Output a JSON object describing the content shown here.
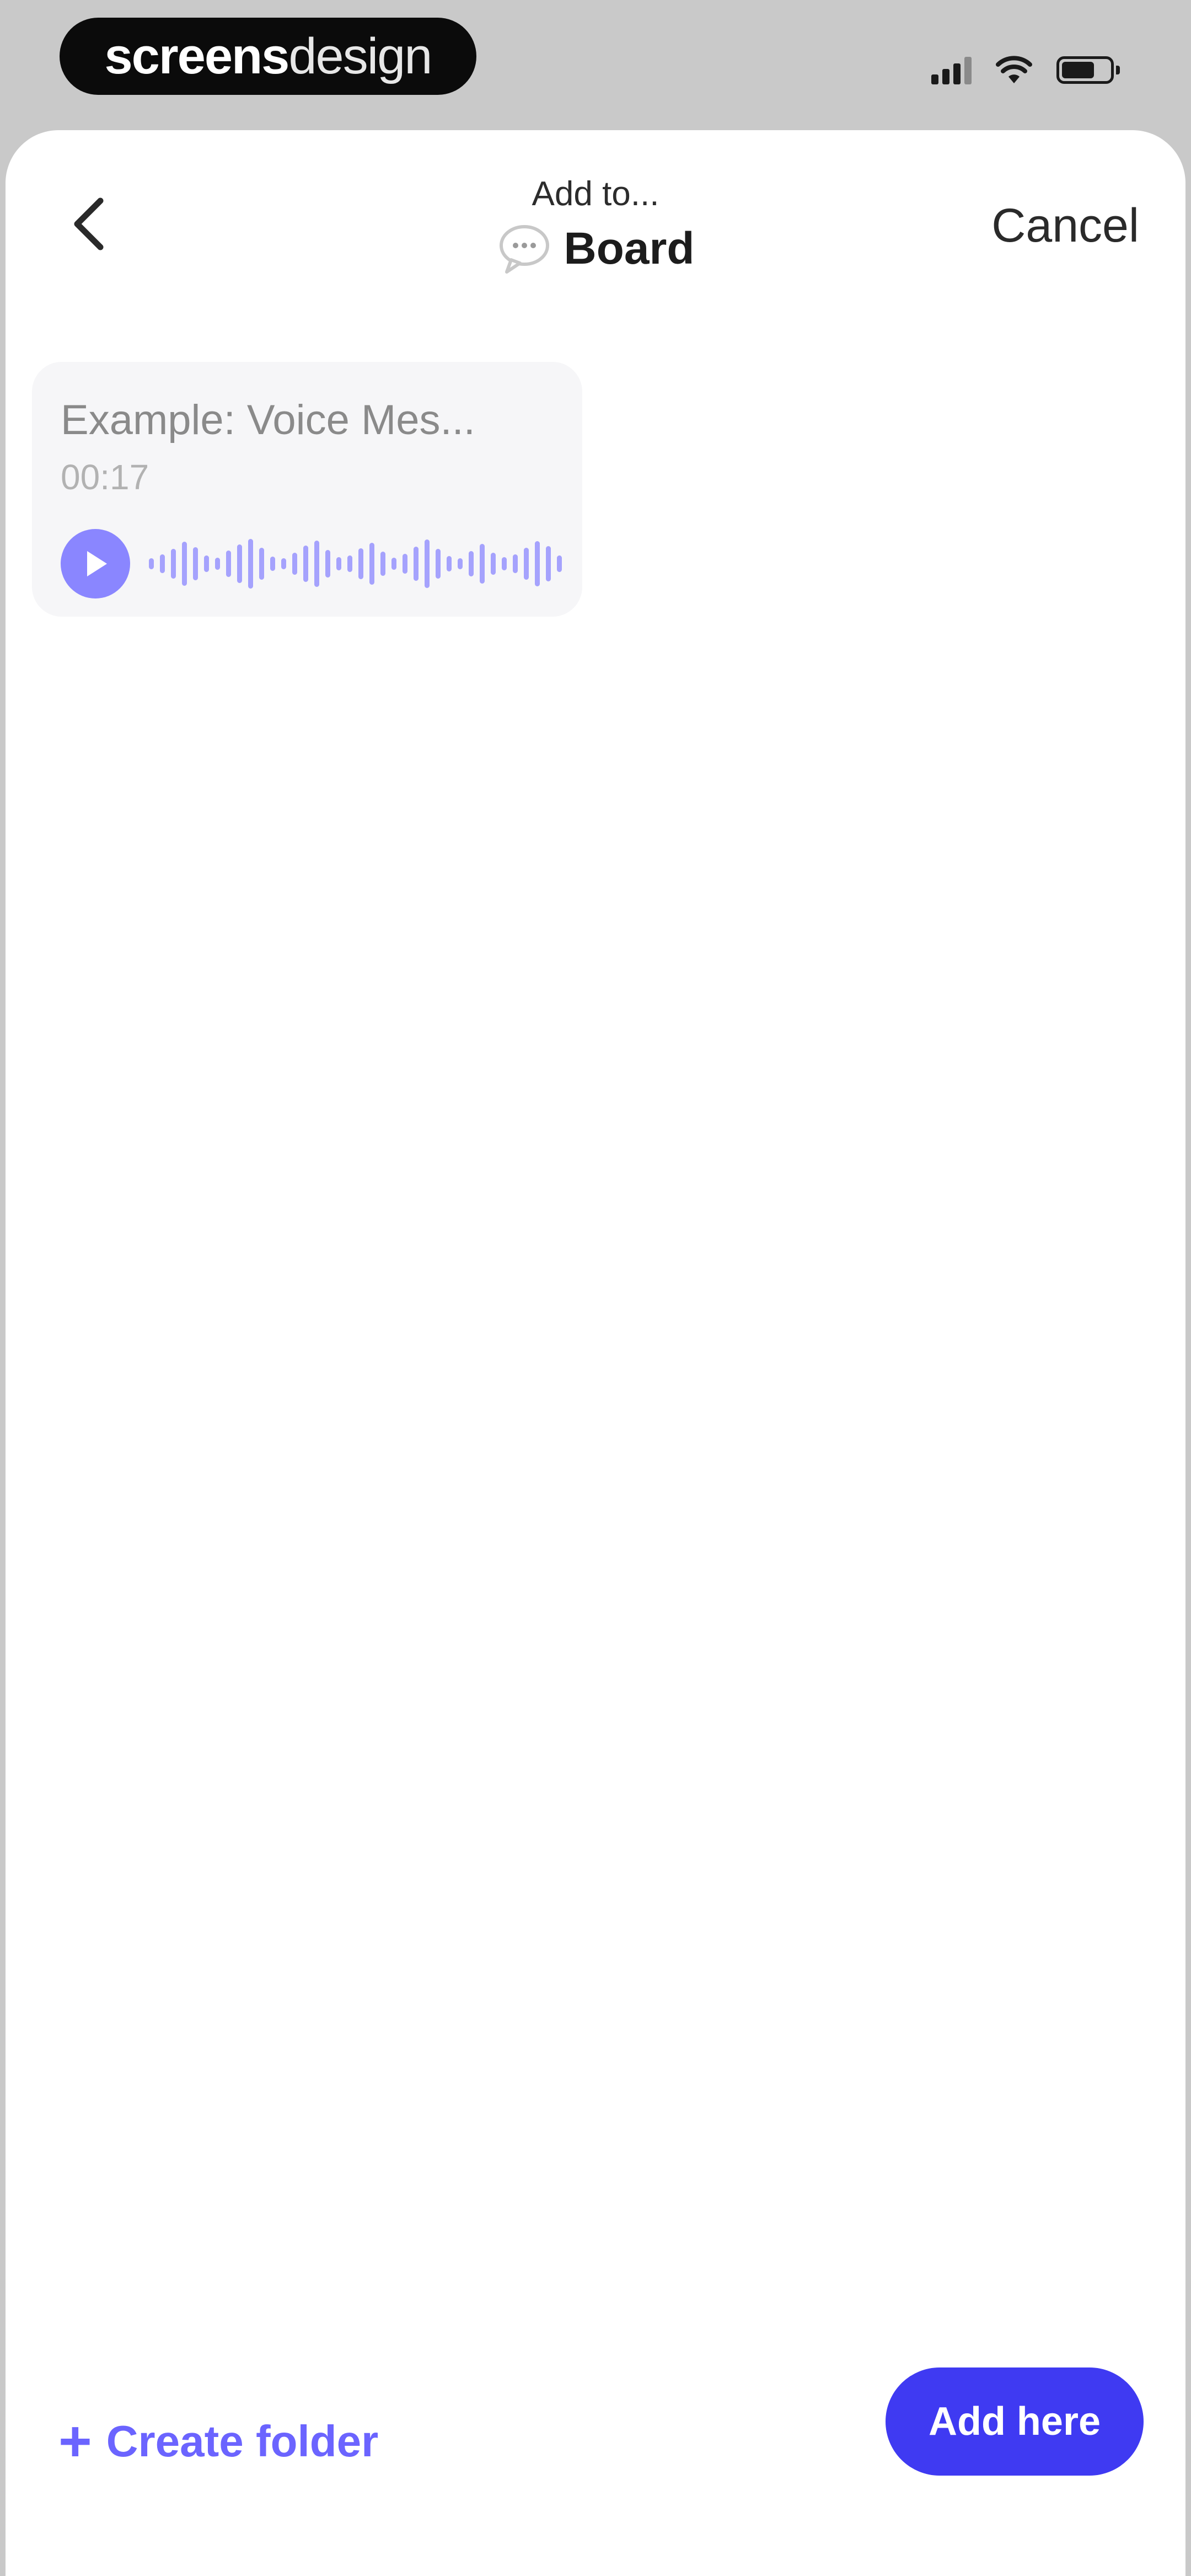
{
  "status_bar": {
    "brand_bold": "screens",
    "brand_light": "design",
    "icons": [
      "cellular-signal-icon",
      "wifi-icon",
      "battery-icon"
    ]
  },
  "nav": {
    "subtitle": "Add to...",
    "title": "Board",
    "title_icon": "speech-bubble-icon",
    "back_icon": "chevron-left-icon",
    "cancel_label": "Cancel"
  },
  "voice_message": {
    "title": "Example: Voice Mes...",
    "duration": "00:17",
    "play_icon": "play-icon",
    "accent_color": "#8a86ff"
  },
  "actions": {
    "create_folder_label": "Create folder",
    "create_folder_icon": "plus-icon",
    "add_here_label": "Add here",
    "primary_color": "#3f3af2"
  }
}
